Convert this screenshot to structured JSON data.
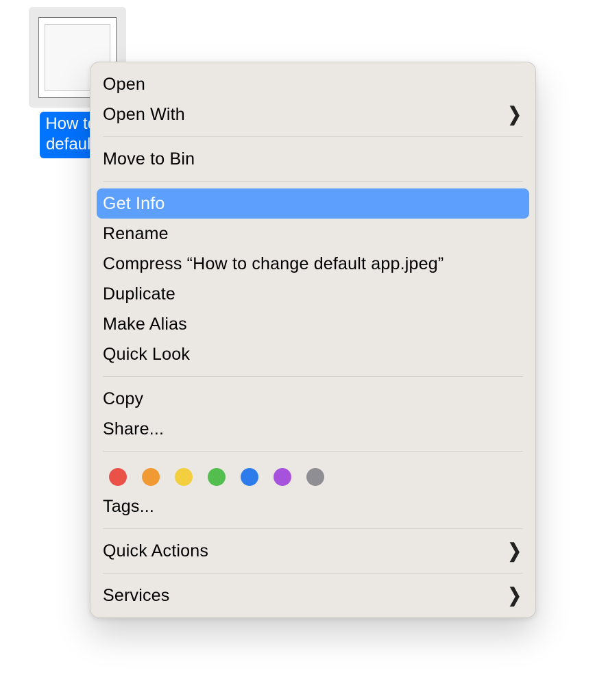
{
  "file": {
    "label": "How to c\ndefault a"
  },
  "context_menu": {
    "open": "Open",
    "open_with": "Open With",
    "move_to_bin": "Move to Bin",
    "get_info": "Get Info",
    "rename": "Rename",
    "compress": "Compress “How to change default app.jpeg”",
    "duplicate": "Duplicate",
    "make_alias": "Make Alias",
    "quick_look": "Quick Look",
    "copy": "Copy",
    "share": "Share...",
    "tags_label": "Tags...",
    "quick_actions": "Quick Actions",
    "services": "Services",
    "highlighted": "get_info",
    "tag_colors": [
      "#EA5248",
      "#F19A33",
      "#F3CE3E",
      "#53BD4E",
      "#2E7BEB",
      "#A752DC",
      "#8E8E93"
    ]
  }
}
